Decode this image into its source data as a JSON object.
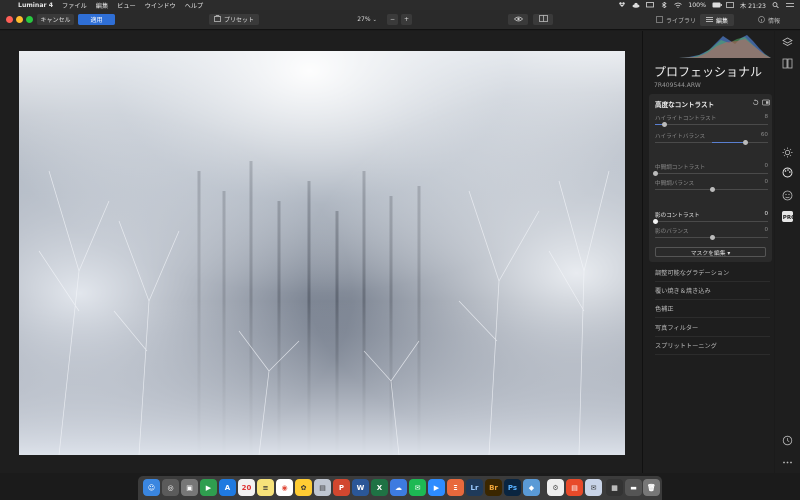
{
  "menubar": {
    "app_name": "Luminar 4",
    "items": [
      "ファイル",
      "編集",
      "ビュー",
      "ウインドウ",
      "ヘルプ"
    ],
    "battery": "100%",
    "clock": "木 21:23"
  },
  "toolbar": {
    "cancel_label": "キャンセル",
    "apply_label": "適用",
    "presets_label": "プリセット",
    "zoom": "27%",
    "zoom_minus": "−",
    "zoom_plus": "+",
    "tabs": [
      "ライブラリ",
      "編集",
      "情報"
    ]
  },
  "panel": {
    "title": "プロフェッショナル",
    "filename": "7R409544.ARW",
    "tool": {
      "name": "高度なコントラスト",
      "sliders": [
        {
          "label": "ハイライトコントラスト",
          "value": "8",
          "fraction": 0.08,
          "active": false
        },
        {
          "label": "ハイライトバランス",
          "value": "60",
          "fraction": 0.8,
          "active": false
        },
        {
          "label": "中間調コントラスト",
          "value": "0",
          "fraction": 0.0,
          "active": false
        },
        {
          "label": "中間調バランス",
          "value": "0",
          "fraction": 0.5,
          "active": false
        },
        {
          "label": "影のコントラスト",
          "value": "0",
          "fraction": 0.0,
          "active": true
        },
        {
          "label": "影のバランス",
          "value": "0",
          "fraction": 0.5,
          "active": false
        }
      ],
      "mask_label": "マスクを編集 ▾"
    },
    "tools": [
      "調整可能なグラデーション",
      "覆い焼き＆焼き込み",
      "色補正",
      "写真フィルター",
      "スプリットトーニング"
    ]
  },
  "colors": {
    "accent": "#2f6fd6",
    "panel_bg": "#1e1e1e",
    "tool_box_bg": "#2a2a2a"
  }
}
